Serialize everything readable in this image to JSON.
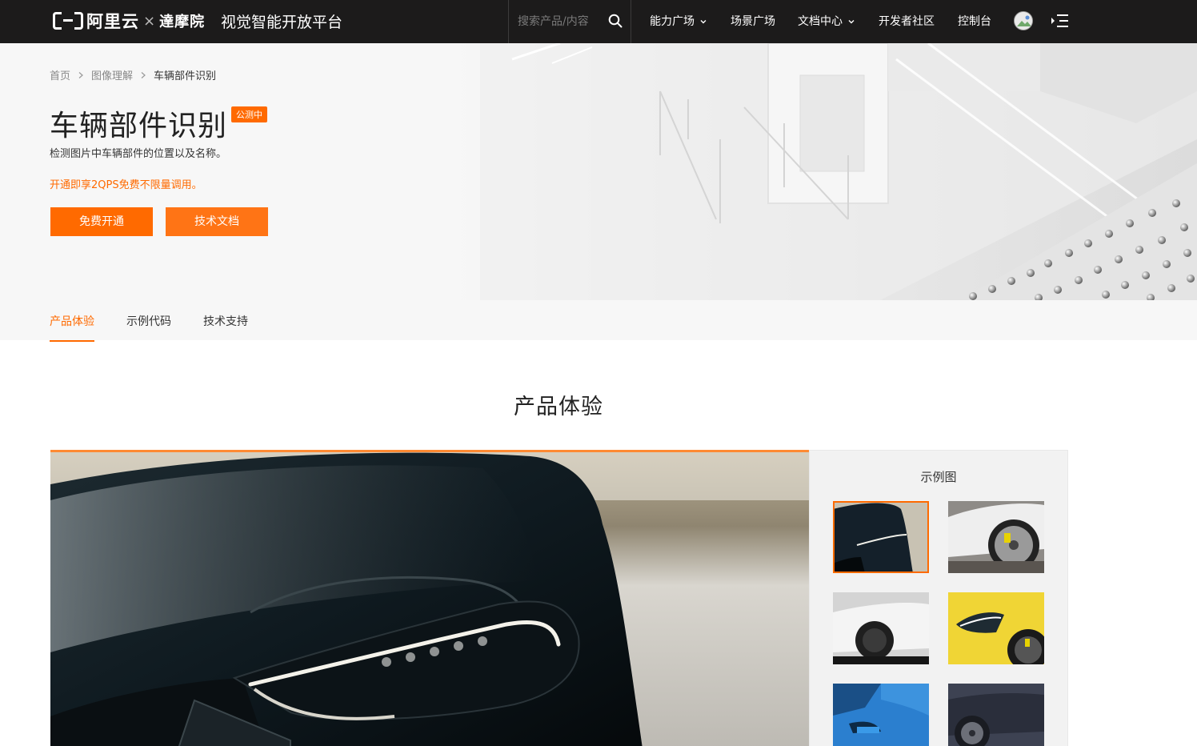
{
  "nav": {
    "logo_aliyun": "阿里云",
    "logo_x": "×",
    "logo_damo": "達摩院",
    "platform_title": "视觉智能开放平台",
    "search_placeholder": "搜索产品/内容",
    "items": [
      {
        "label": "能力广场",
        "dropdown": true
      },
      {
        "label": "场景广场",
        "dropdown": false
      },
      {
        "label": "文档中心",
        "dropdown": true
      },
      {
        "label": "开发者社区",
        "dropdown": false
      },
      {
        "label": "控制台",
        "dropdown": false
      }
    ],
    "icons": [
      "search-icon",
      "chevron-down-icon",
      "avatar",
      "menu-icon"
    ]
  },
  "breadcrumb": {
    "items": [
      "首页",
      "图像理解",
      "车辆部件识别"
    ]
  },
  "hero": {
    "title": "车辆部件识别",
    "badge": "公测中",
    "description": "检测图片中车辆部件的位置以及名称。",
    "promo": "开通即享2QPS免费不限量调用。",
    "primary_button": "免费开通",
    "secondary_button": "技术文档"
  },
  "tabs": [
    {
      "label": "产品体验",
      "active": true
    },
    {
      "label": "示例代码",
      "active": false
    },
    {
      "label": "技术支持",
      "active": false
    }
  ],
  "section": {
    "title": "产品体验",
    "sample_title": "示例图",
    "selected_thumbnail": 1,
    "thumbnail_count": 6
  },
  "colors": {
    "accent": "#ff6a00",
    "nav_bg": "#1c1b1b",
    "hero_bg": "#f7f7f7",
    "panel_bg": "#f2f2f2"
  }
}
